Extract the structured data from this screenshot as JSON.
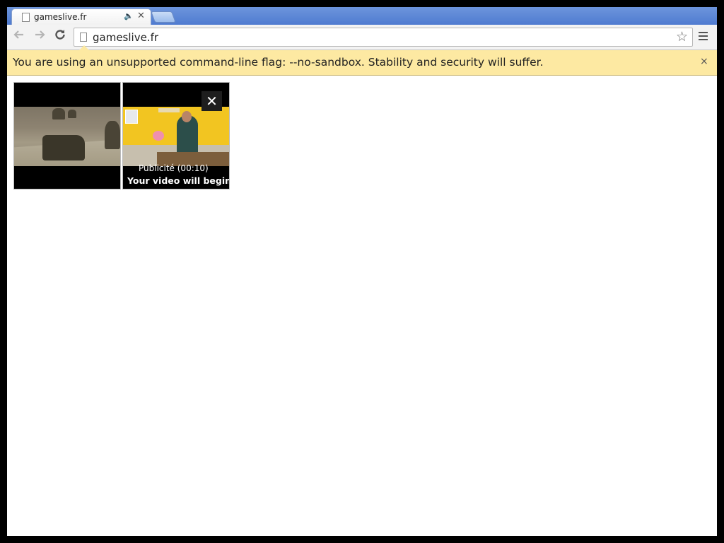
{
  "tab": {
    "title": "gameslive.fr",
    "page_icon": "page-icon",
    "audio_icon": "speaker-icon",
    "close_glyph": "✕"
  },
  "toolbar": {
    "back_glyph": "🡐",
    "forward_glyph": "🡒",
    "reload_glyph": "↻",
    "url": "gameslive.fr",
    "star_glyph": "☆"
  },
  "infobar": {
    "message": "You are using an unsupported command-line flag: --no-sandbox. Stability and security will suffer.",
    "close_glyph": "×"
  },
  "ad": {
    "close_glyph": "✕",
    "label": "Publicité   (00:10)",
    "message": "Your video will begin"
  }
}
